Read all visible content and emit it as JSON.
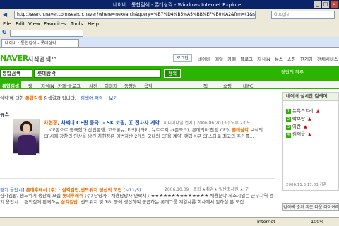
{
  "window": {
    "title": "네이버 : 통합검색 - 롯데삼각 - Windows Internet Explorer",
    "controls": [
      "_",
      "□",
      "×"
    ]
  },
  "address": {
    "url": "http://search.naver.com/search.naver?where=nexearch&query=%B7%D4%B5%A5%BB%EF%B0%A2&frm=t1&sm=top_hty",
    "search_placeholder": "Google"
  },
  "menu": [
    "File",
    "Edit",
    "View",
    "Favorites",
    "Tools",
    "Help"
  ],
  "tab": {
    "label": "네이버 : 통합검색 - 롯데삼각"
  },
  "naver": {
    "logo": "NAVER",
    "logo_sub": "지식검색™",
    "login": "로그인",
    "topnav": [
      "네이버",
      "메일",
      "카페",
      "블로그",
      "지식iN",
      "뉴스",
      "쇼핑",
      "한게임",
      "전체서비스"
    ],
    "search_category": "통합검색",
    "search_query": "롯데삼각",
    "search_button": "검색",
    "promo": "장만의 하루,",
    "tabs": [
      "통합검색",
      "웹",
      "지식iN",
      "카페·블로그",
      "사전",
      "이미지",
      "동영상",
      "음악",
      "책",
      "쇼핑",
      "내PC"
    ]
  },
  "notice": {
    "prefix": "삼각'에 대한 ",
    "em": "통합검색",
    "suffix": " 검색결과 입니다.",
    "link1": "검색어 저장",
    "link2": "보기"
  },
  "section_title": "뉴스",
  "news1": {
    "title_hl": "차현정",
    "title_rest": ", 차세대 CF퀸 등극! - SK 코핑, ⓔ 전자사 계약",
    "meta": "미디어다임 연예 | 2006.06.20 (화) 오후 2:05",
    "body_a": "... CF판으로 등극했다.산업은행, 코오롱뉴, 타키니타키, 뉴트로지나(존쿡스), 롯데리아'찬양 CF'), ",
    "body_hl": "롯데삼각",
    "body_b": " 보석의 CF시에 강한의 인상을 남긴 차현정은 이번하반 2개의 국내외 CF을 계약, 팬입성부 CF스타로 최고의 주가를..."
  },
  "news2": {
    "title_a": "경기 용인시] ",
    "title_hl": "롯데후레쉬 (주) : 삼각김밥,샌드위치 생산직 모집",
    "title_b": " (~11/5)",
    "meta": "2006.10.09 | 조회 ★취업★ 일반조사원 ★ 구",
    "body_a": "삼각김밥, 샌드위치 생산직 모집 ",
    "body_hl": "롯데후레쉬",
    "body_b": " (주) 당당자 : 채용담당자 연락처 : ★★★★★★★★★★★★★★ 채용분야 제조기업는 근무지역 경기 용인시... 편의점에 판매하는 ",
    "body_hl2": "삼각김밥",
    "body_c": ", 샌드위치 및 TGI 등에 생산하며 공급하는 롯데그룹 계열사롭 회사에서 일하실 분 모집..."
  },
  "rpanel": {
    "title": "네이버 실시간 검색어",
    "items": [
      {
        "rank": "1",
        "label": "뉴욕스트리",
        "change": "▲"
      },
      {
        "rank": "2",
        "label": "박보람",
        "change": "▲"
      },
      {
        "rank": "3",
        "label": "아칸",
        "change": "▲"
      },
      {
        "rank": "4",
        "label": "김재욱",
        "change": "▲"
      }
    ],
    "date": "2006.11.3  17:03 기준",
    "button": "검색에 순위 혹은 다운 다이어리 ▼"
  },
  "status": {
    "text": "",
    "zone": "Internet",
    "zoom": "100%"
  },
  "colors": {
    "brand_green": "#2db400",
    "highlight_orange": "#e46b00",
    "link_blue": "#1a4ea8"
  }
}
